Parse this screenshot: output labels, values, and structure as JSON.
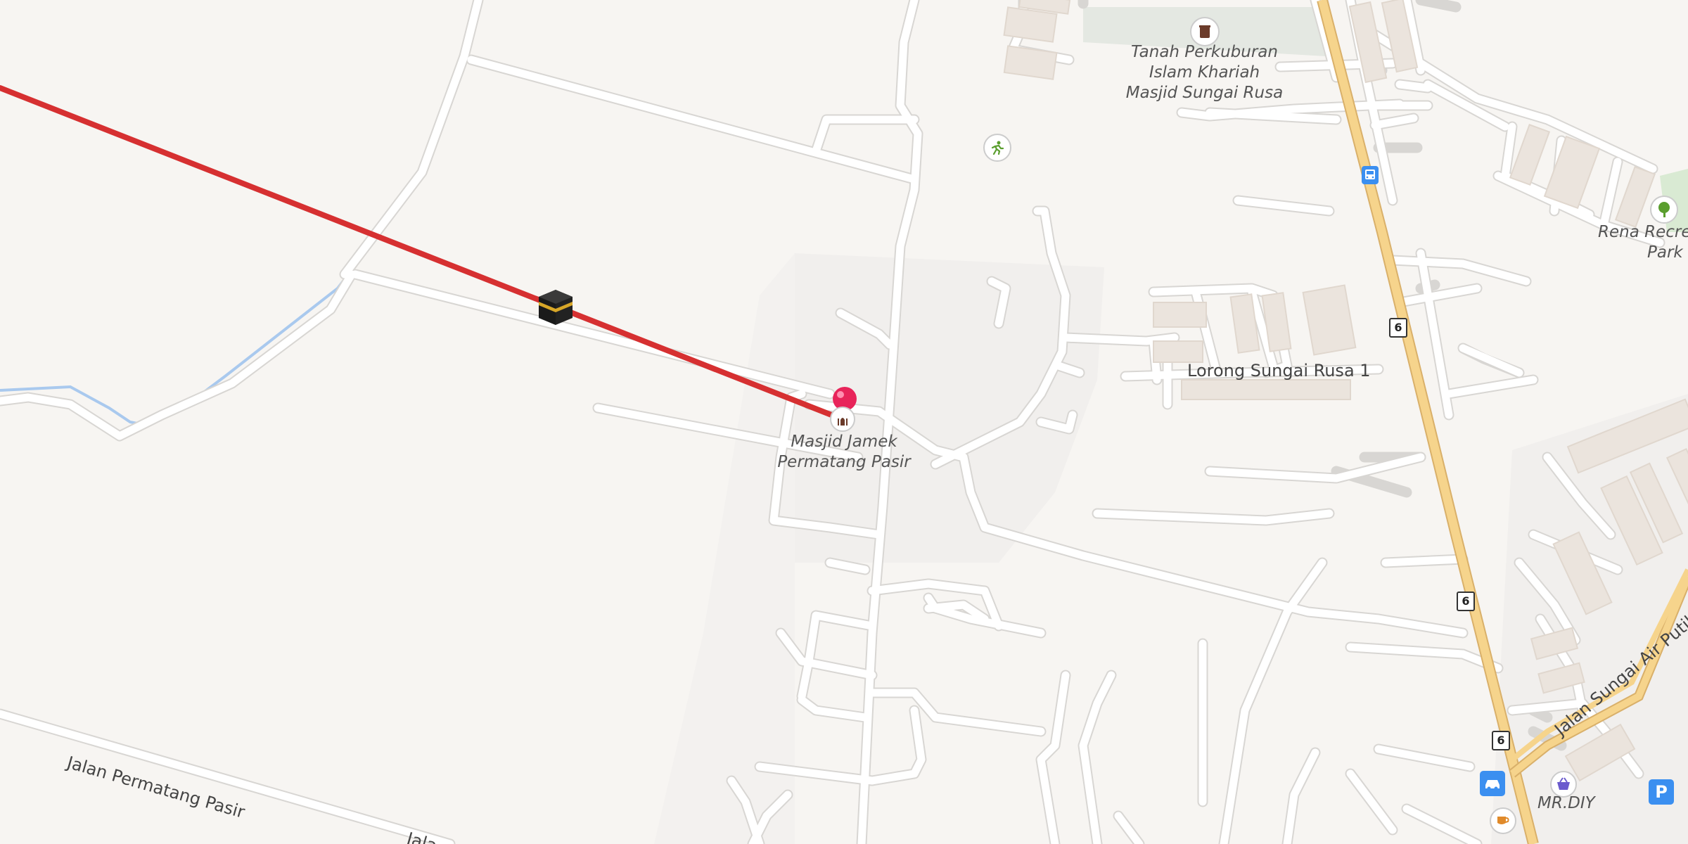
{
  "map": {
    "labels": {
      "mosque": [
        "Masjid Jamek",
        "Permatang Pasir"
      ],
      "cemetery": [
        "Tanah Perkuburan",
        "Islam Khariah",
        "Masjid Sungai Rusa"
      ],
      "park": [
        "Rena Recrea",
        "Park"
      ],
      "shop": "MR.DIY"
    },
    "streets": {
      "lorong": "Lorong Sungai Rusa 1",
      "permatang": "Jalan Permatang Pasir",
      "permatang_cut": "Jala",
      "air_putih": "Jalan Sungai Air Putih"
    },
    "route_shields": [
      "6",
      "6",
      "6"
    ],
    "icons": {
      "kaaba": "kaaba-icon",
      "pin": "location-pin-icon",
      "mosque": "mosque-icon",
      "cemetery": "cemetery-icon",
      "sport": "running-icon",
      "bus": "bus-stop-icon",
      "tree": "tree-icon",
      "shop": "shopping-basket-icon",
      "car": "car-icon",
      "parking": "parking-icon",
      "cafe": "cafe-icon"
    },
    "parking_letter": "P",
    "colors": {
      "qibla_line": "#d63031",
      "highway": "#f6d48c",
      "river": "#a9c9ee",
      "pin": "#e8245a"
    }
  }
}
